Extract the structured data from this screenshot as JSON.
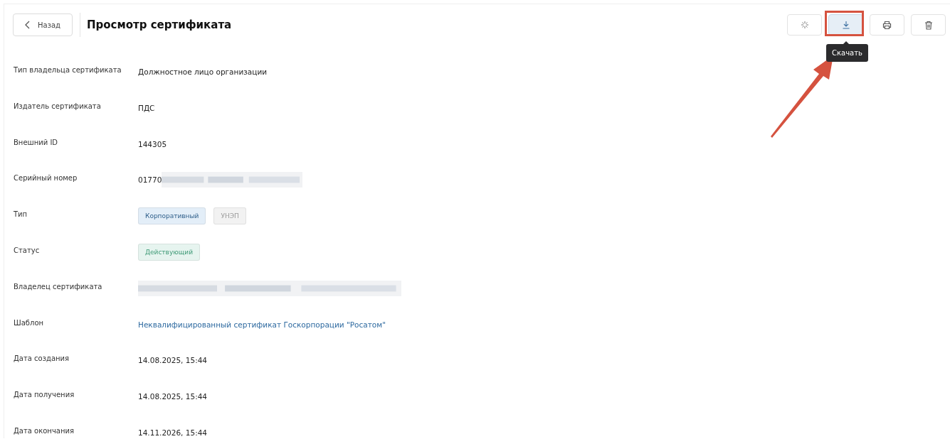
{
  "header": {
    "back": "Назад",
    "title": "Просмотр сертификата"
  },
  "actions": [
    {
      "kind": "sparkle",
      "selected": false,
      "highlighted": false
    },
    {
      "kind": "download",
      "selected": true,
      "highlighted": true,
      "tooltip": "Скачать"
    },
    {
      "kind": "print",
      "selected": false,
      "highlighted": false
    },
    {
      "kind": "trash",
      "selected": false,
      "highlighted": false
    }
  ],
  "fields": [
    {
      "label": "Тип владельца сертификата",
      "kind": "text",
      "value": "Должностное лицо организации"
    },
    {
      "label": "Издатель сертификата",
      "kind": "text",
      "value": "ПДС"
    },
    {
      "label": "Внешний ID",
      "kind": "text",
      "value": "144305"
    },
    {
      "label": "Серийный номер",
      "kind": "redacted",
      "value": "01770"
    },
    {
      "label": "Тип",
      "kind": "tags",
      "tags": [
        {
          "text": "Корпоративный",
          "color": "#e3eef8"
        },
        {
          "text": "УНЭП",
          "color": "#f2f2f2"
        }
      ]
    },
    {
      "label": "Статус",
      "kind": "tags",
      "tags": [
        {
          "text": "Действующий",
          "color": "#e6f4ef"
        }
      ]
    },
    {
      "label": "Владелец сертификата",
      "kind": "redacted"
    },
    {
      "label": "Шаблон",
      "kind": "link",
      "value": "Неквалифицированный сертификат Госкорпорации \"Росатом\""
    },
    {
      "label": "Дата создания",
      "kind": "text",
      "value": "14.08.2025, 15:44"
    },
    {
      "label": "Дата получения",
      "kind": "text",
      "value": "14.08.2025, 15:44"
    },
    {
      "label": "Дата окончания",
      "kind": "text",
      "value": "14.11.2026, 15:44"
    }
  ]
}
